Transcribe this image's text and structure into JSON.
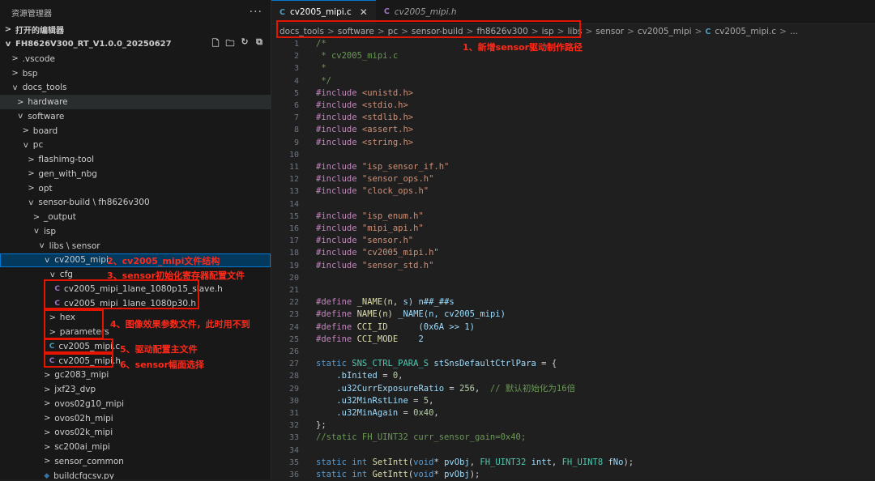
{
  "explorer": {
    "title": "资源管理器",
    "more": "···",
    "open_editors": "打开的编辑器",
    "root": "FH8626V300_RT_V1.0.0_20250627",
    "items": [
      {
        "label": ".vscode",
        "depth": 1,
        "chev": ">"
      },
      {
        "label": "bsp",
        "depth": 1,
        "chev": ">"
      },
      {
        "label": "docs_tools",
        "depth": 1,
        "chev": "v"
      },
      {
        "label": "hardware",
        "depth": 2,
        "chev": ">"
      },
      {
        "label": "software",
        "depth": 2,
        "chev": "v"
      },
      {
        "label": "board",
        "depth": 3,
        "chev": ">"
      },
      {
        "label": "pc",
        "depth": 3,
        "chev": "v"
      },
      {
        "label": "flashimg-tool",
        "depth": 4,
        "chev": ">"
      },
      {
        "label": "gen_with_nbg",
        "depth": 4,
        "chev": ">"
      },
      {
        "label": "opt",
        "depth": 4,
        "chev": ">"
      },
      {
        "label": "sensor-build \\ fh8626v300",
        "depth": 4,
        "chev": "v"
      },
      {
        "label": "_output",
        "depth": 5,
        "chev": ">"
      },
      {
        "label": "isp",
        "depth": 5,
        "chev": "v"
      },
      {
        "label": "libs \\ sensor",
        "depth": 6,
        "chev": "v"
      },
      {
        "label": "cv2005_mipi",
        "depth": 7,
        "chev": "v"
      },
      {
        "label": "cfg",
        "depth": 8,
        "chev": "v"
      },
      {
        "label": "cv2005_mipi_1lane_1080p15_slave.h",
        "depth": 9,
        "chev": "",
        "icon": "C"
      },
      {
        "label": "cv2005_mipi_1lane_1080p30.h",
        "depth": 9,
        "chev": "",
        "icon": "C"
      },
      {
        "label": "hex",
        "depth": 8,
        "chev": ">"
      },
      {
        "label": "parameters",
        "depth": 8,
        "chev": ">"
      },
      {
        "label": "cv2005_mipi.c",
        "depth": 8,
        "chev": "",
        "icon": "C"
      },
      {
        "label": "cv2005_mipi.h",
        "depth": 8,
        "chev": "",
        "icon": "C"
      },
      {
        "label": "gc2083_mipi",
        "depth": 7,
        "chev": ">"
      },
      {
        "label": "jxf23_dvp",
        "depth": 7,
        "chev": ">"
      },
      {
        "label": "ovos02g10_mipi",
        "depth": 7,
        "chev": ">"
      },
      {
        "label": "ovos02h_mipi",
        "depth": 7,
        "chev": ">"
      },
      {
        "label": "ovos02k_mipi",
        "depth": 7,
        "chev": ">"
      },
      {
        "label": "sc200ai_mipi",
        "depth": 7,
        "chev": ">"
      },
      {
        "label": "sensor_common",
        "depth": 7,
        "chev": ">"
      },
      {
        "label": "buildcfgcsv.py",
        "depth": 7,
        "chev": "",
        "icon": "py"
      }
    ]
  },
  "annotations": {
    "a1": "1、新增sensor驱动制作路径",
    "a2": "2、cv2005_mipi文件结构",
    "a3": "3、sensor初始化寄存器配置文件",
    "a4": "4、图像效果参数文件，此时用不到",
    "a5": "5、驱动配置主文件",
    "a6": "6、sensor幅面选择"
  },
  "tabs": [
    {
      "icon": "C",
      "label": "cv2005_mipi.c",
      "close": "✕"
    },
    {
      "icon": "C",
      "label": "cv2005_mipi.h"
    }
  ],
  "breadcrumbs": [
    "docs_tools",
    "software",
    "pc",
    "sensor-build",
    "fh8626v300",
    "isp",
    "libs",
    "sensor",
    "cv2005_mipi",
    "cv2005_mipi.c",
    "..."
  ],
  "code": {
    "line_numbers": [
      "1",
      "2",
      "3",
      "4",
      "5",
      "6",
      "7",
      "8",
      "9",
      "10",
      "11",
      "12",
      "13",
      "14",
      "15",
      "16",
      "17",
      "18",
      "19",
      "20",
      "21",
      "22",
      "23",
      "24",
      "25",
      "26",
      "27",
      "28",
      "29",
      "30",
      "31",
      "32",
      "33",
      "34",
      "35",
      "36"
    ],
    "lines": [
      "/*",
      " * cv2005_mipi.c",
      " *",
      " */",
      "#include <unistd.h>",
      "#include <stdio.h>",
      "#include <stdlib.h>",
      "#include <assert.h>",
      "#include <string.h>",
      "",
      "#include \"isp_sensor_if.h\"",
      "#include \"sensor_ops.h\"",
      "#include \"clock_ops.h\"",
      "",
      "#include \"isp_enum.h\"",
      "#include \"mipi_api.h\"",
      "#include \"sensor.h\"",
      "#include \"cv2005_mipi.h\"",
      "#include \"sensor_std.h\"",
      "",
      "",
      "#define _NAME(n, s) n##_##s",
      "#define NAME(n) _NAME(n, cv2005_mipi)",
      "#define CCI_ID      (0x6A >> 1)",
      "#define CCI_MODE    2",
      "",
      "static SNS_CTRL_PARA_S stSnsDefaultCtrlPara = {",
      "    .bInited = 0,",
      "    .u32CurrExposureRatio = 256,  // 默认初始化为16倍",
      "    .u32MinRstLine = 5,",
      "    .u32MinAgain = 0x40,",
      "};",
      "//static FH_UINT32 curr_sensor_gain=0x40;",
      "",
      "static int SetIntt(void* pvObj, FH_UINT32 intt, FH_UINT8 fNo);",
      "static int GetIntt(void* pvObj);"
    ]
  }
}
